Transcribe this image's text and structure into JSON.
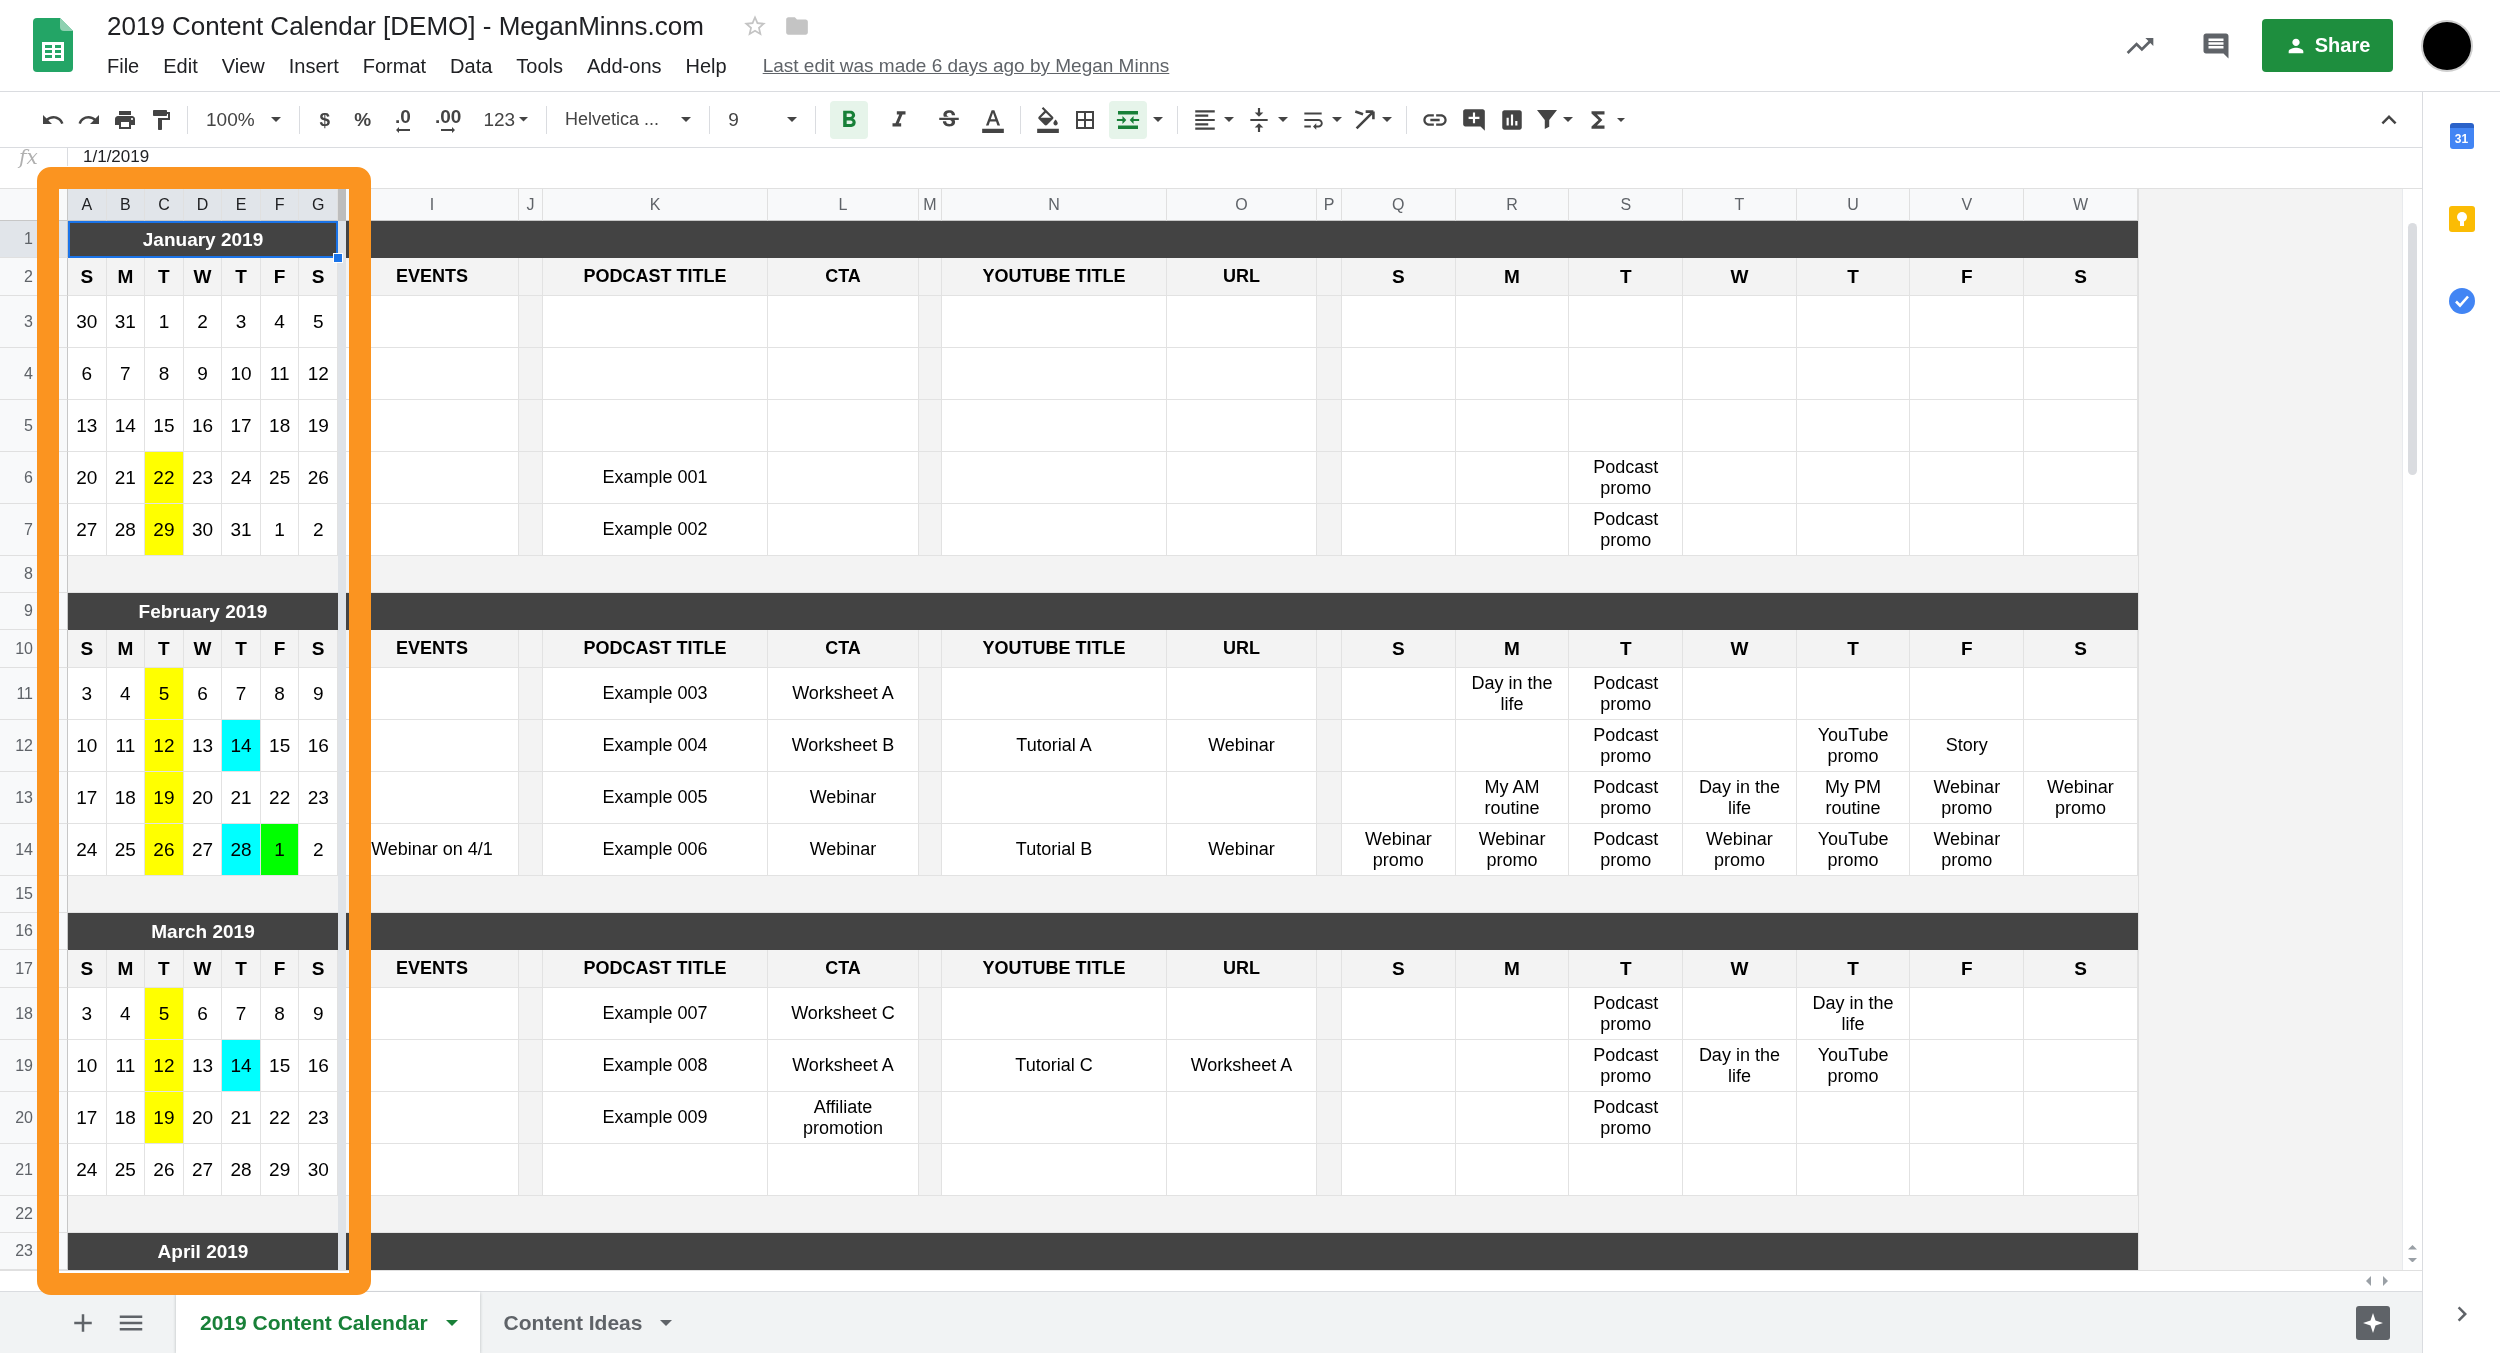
{
  "header": {
    "title": "2019 Content Calendar [DEMO] - MeganMinns.com",
    "starred": false,
    "menu": [
      "File",
      "Edit",
      "View",
      "Insert",
      "Format",
      "Data",
      "Tools",
      "Add-ons",
      "Help"
    ],
    "last_edit": "Last edit was made 6 days ago by Megan Minns",
    "share": "Share"
  },
  "toolbar": {
    "zoom": "100%",
    "formats": [
      "$",
      "%",
      ".0",
      ".00",
      "123"
    ],
    "font": "Helvetica ...",
    "font_size": "9",
    "bold": true,
    "italic": false,
    "strikethrough": false,
    "merge": true
  },
  "formula_bar": {
    "label": "fx",
    "value": "1/1/2019"
  },
  "sheet": {
    "frozen_columns": [
      "A",
      "B",
      "C",
      "D",
      "E",
      "F",
      "G"
    ],
    "columns": [
      "I",
      "J",
      "K",
      "L",
      "M",
      "N",
      "O",
      "P",
      "Q",
      "R",
      "S",
      "T",
      "U",
      "V",
      "W"
    ],
    "row_numbers": [
      "1",
      "2",
      "3",
      "4",
      "5",
      "6",
      "7",
      "8",
      "9",
      "10",
      "11",
      "12",
      "13",
      "14",
      "15",
      "16",
      "17",
      "18",
      "19",
      "20",
      "21",
      "22",
      "23"
    ],
    "months": [
      {
        "title": "January 2019",
        "selected": true,
        "weekdays": [
          "S",
          "M",
          "T",
          "W",
          "T",
          "F",
          "S"
        ],
        "headings": [
          "EVENTS",
          "PODCAST TITLE",
          "CTA",
          "YOUTUBE TITLE",
          "URL"
        ],
        "post_days": [
          "S",
          "M",
          "T",
          "W",
          "T",
          "F",
          "S"
        ],
        "weeks": [
          {
            "days": [
              {
                "date": "30"
              },
              {
                "date": "31"
              },
              {
                "date": "1"
              },
              {
                "date": "2"
              },
              {
                "date": "3"
              },
              {
                "date": "4"
              },
              {
                "date": "5"
              }
            ]
          },
          {
            "days": [
              {
                "date": "6"
              },
              {
                "date": "7"
              },
              {
                "date": "8"
              },
              {
                "date": "9"
              },
              {
                "date": "10"
              },
              {
                "date": "11"
              },
              {
                "date": "12"
              }
            ]
          },
          {
            "days": [
              {
                "date": "13"
              },
              {
                "date": "14"
              },
              {
                "date": "15"
              },
              {
                "date": "16"
              },
              {
                "date": "17"
              },
              {
                "date": "18"
              },
              {
                "date": "19"
              }
            ]
          },
          {
            "days": [
              {
                "date": "20"
              },
              {
                "date": "21"
              },
              {
                "date": "22",
                "color": "#ffff00"
              },
              {
                "date": "23"
              },
              {
                "date": "24"
              },
              {
                "date": "25"
              },
              {
                "date": "26"
              }
            ],
            "podcast_title": "Example 001",
            "posts": {
              "tuesday": "Podcast promo"
            }
          },
          {
            "days": [
              {
                "date": "27"
              },
              {
                "date": "28"
              },
              {
                "date": "29",
                "color": "#ffff00"
              },
              {
                "date": "30"
              },
              {
                "date": "31"
              },
              {
                "date": "1"
              },
              {
                "date": "2"
              }
            ],
            "podcast_title": "Example 002",
            "posts": {
              "tuesday": "Podcast promo"
            }
          }
        ]
      },
      {
        "title": "February 2019",
        "selected": false,
        "weekdays": [
          "S",
          "M",
          "T",
          "W",
          "T",
          "F",
          "S"
        ],
        "headings": [
          "EVENTS",
          "PODCAST TITLE",
          "CTA",
          "YOUTUBE TITLE",
          "URL"
        ],
        "post_days": [
          "S",
          "M",
          "T",
          "W",
          "T",
          "F",
          "S"
        ],
        "weeks": [
          {
            "days": [
              {
                "date": "3"
              },
              {
                "date": "4"
              },
              {
                "date": "5",
                "color": "#ffff00"
              },
              {
                "date": "6"
              },
              {
                "date": "7"
              },
              {
                "date": "8"
              },
              {
                "date": "9"
              }
            ],
            "podcast_title": "Example 003",
            "cta": "Worksheet A",
            "posts": {
              "monday": "Day in the life",
              "tuesday": "Podcast promo"
            }
          },
          {
            "days": [
              {
                "date": "10"
              },
              {
                "date": "11"
              },
              {
                "date": "12",
                "color": "#ffff00"
              },
              {
                "date": "13"
              },
              {
                "date": "14",
                "color": "#00ffff"
              },
              {
                "date": "15"
              },
              {
                "date": "16"
              }
            ],
            "podcast_title": "Example 004",
            "cta": "Worksheet B",
            "youtube_title": "Tutorial A",
            "url": "Webinar",
            "posts": {
              "tuesday": "Podcast promo",
              "thursday": "YouTube promo",
              "friday": "Story"
            }
          },
          {
            "days": [
              {
                "date": "17"
              },
              {
                "date": "18"
              },
              {
                "date": "19",
                "color": "#ffff00"
              },
              {
                "date": "20"
              },
              {
                "date": "21"
              },
              {
                "date": "22"
              },
              {
                "date": "23"
              }
            ],
            "podcast_title": "Example 005",
            "cta": "Webinar",
            "posts": {
              "monday": "My AM routine",
              "tuesday": "Podcast promo",
              "wednesday": "Day in the life",
              "thursday": "My PM routine",
              "friday": "Webinar promo",
              "saturday": "Webinar promo"
            }
          },
          {
            "days": [
              {
                "date": "24"
              },
              {
                "date": "25"
              },
              {
                "date": "26",
                "color": "#ffff00"
              },
              {
                "date": "27"
              },
              {
                "date": "28",
                "color": "#00ffff"
              },
              {
                "date": "1",
                "color": "#00ff00"
              },
              {
                "date": "2"
              }
            ],
            "events": "Webinar on 4/1",
            "podcast_title": "Example 006",
            "cta": "Webinar",
            "youtube_title": "Tutorial B",
            "url": "Webinar",
            "posts": {
              "sunday": "Webinar promo",
              "monday": "Webinar promo",
              "tuesday": "Podcast promo",
              "wednesday": "Webinar promo",
              "thursday": "YouTube promo",
              "friday": "Webinar promo"
            }
          }
        ]
      },
      {
        "title": "March 2019",
        "selected": false,
        "weekdays": [
          "S",
          "M",
          "T",
          "W",
          "T",
          "F",
          "S"
        ],
        "headings": [
          "EVENTS",
          "PODCAST TITLE",
          "CTA",
          "YOUTUBE TITLE",
          "URL"
        ],
        "post_days": [
          "S",
          "M",
          "T",
          "W",
          "T",
          "F",
          "S"
        ],
        "weeks": [
          {
            "days": [
              {
                "date": "3"
              },
              {
                "date": "4"
              },
              {
                "date": "5",
                "color": "#ffff00"
              },
              {
                "date": "6"
              },
              {
                "date": "7"
              },
              {
                "date": "8"
              },
              {
                "date": "9"
              }
            ],
            "podcast_title": "Example 007",
            "cta": "Worksheet C",
            "posts": {
              "tuesday": "Podcast promo",
              "thursday": "Day in the life"
            }
          },
          {
            "days": [
              {
                "date": "10"
              },
              {
                "date": "11"
              },
              {
                "date": "12",
                "color": "#ffff00"
              },
              {
                "date": "13"
              },
              {
                "date": "14",
                "color": "#00ffff"
              },
              {
                "date": "15"
              },
              {
                "date": "16"
              }
            ],
            "podcast_title": "Example 008",
            "cta": "Worksheet A",
            "youtube_title": "Tutorial C",
            "url": "Worksheet A",
            "posts": {
              "tuesday": "Podcast promo",
              "wednesday": "Day in the life",
              "thursday": "YouTube promo"
            }
          },
          {
            "days": [
              {
                "date": "17"
              },
              {
                "date": "18"
              },
              {
                "date": "19",
                "color": "#ffff00"
              },
              {
                "date": "20"
              },
              {
                "date": "21"
              },
              {
                "date": "22"
              },
              {
                "date": "23"
              }
            ],
            "podcast_title": "Example 009",
            "cta": "Affiliate promotion",
            "posts": {
              "tuesday": "Podcast promo"
            }
          },
          {
            "days": [
              {
                "date": "24"
              },
              {
                "date": "25"
              },
              {
                "date": "26"
              },
              {
                "date": "27"
              },
              {
                "date": "28"
              },
              {
                "date": "29"
              },
              {
                "date": "30"
              }
            ]
          }
        ]
      },
      {
        "title": "April 2019",
        "selected": false
      }
    ]
  },
  "sheet_tabs": [
    {
      "label": "2019 Content Calendar",
      "selected": true
    },
    {
      "label": "Content Ideas",
      "selected": false
    }
  ],
  "side_panel": {
    "calendar_day": "31"
  }
}
